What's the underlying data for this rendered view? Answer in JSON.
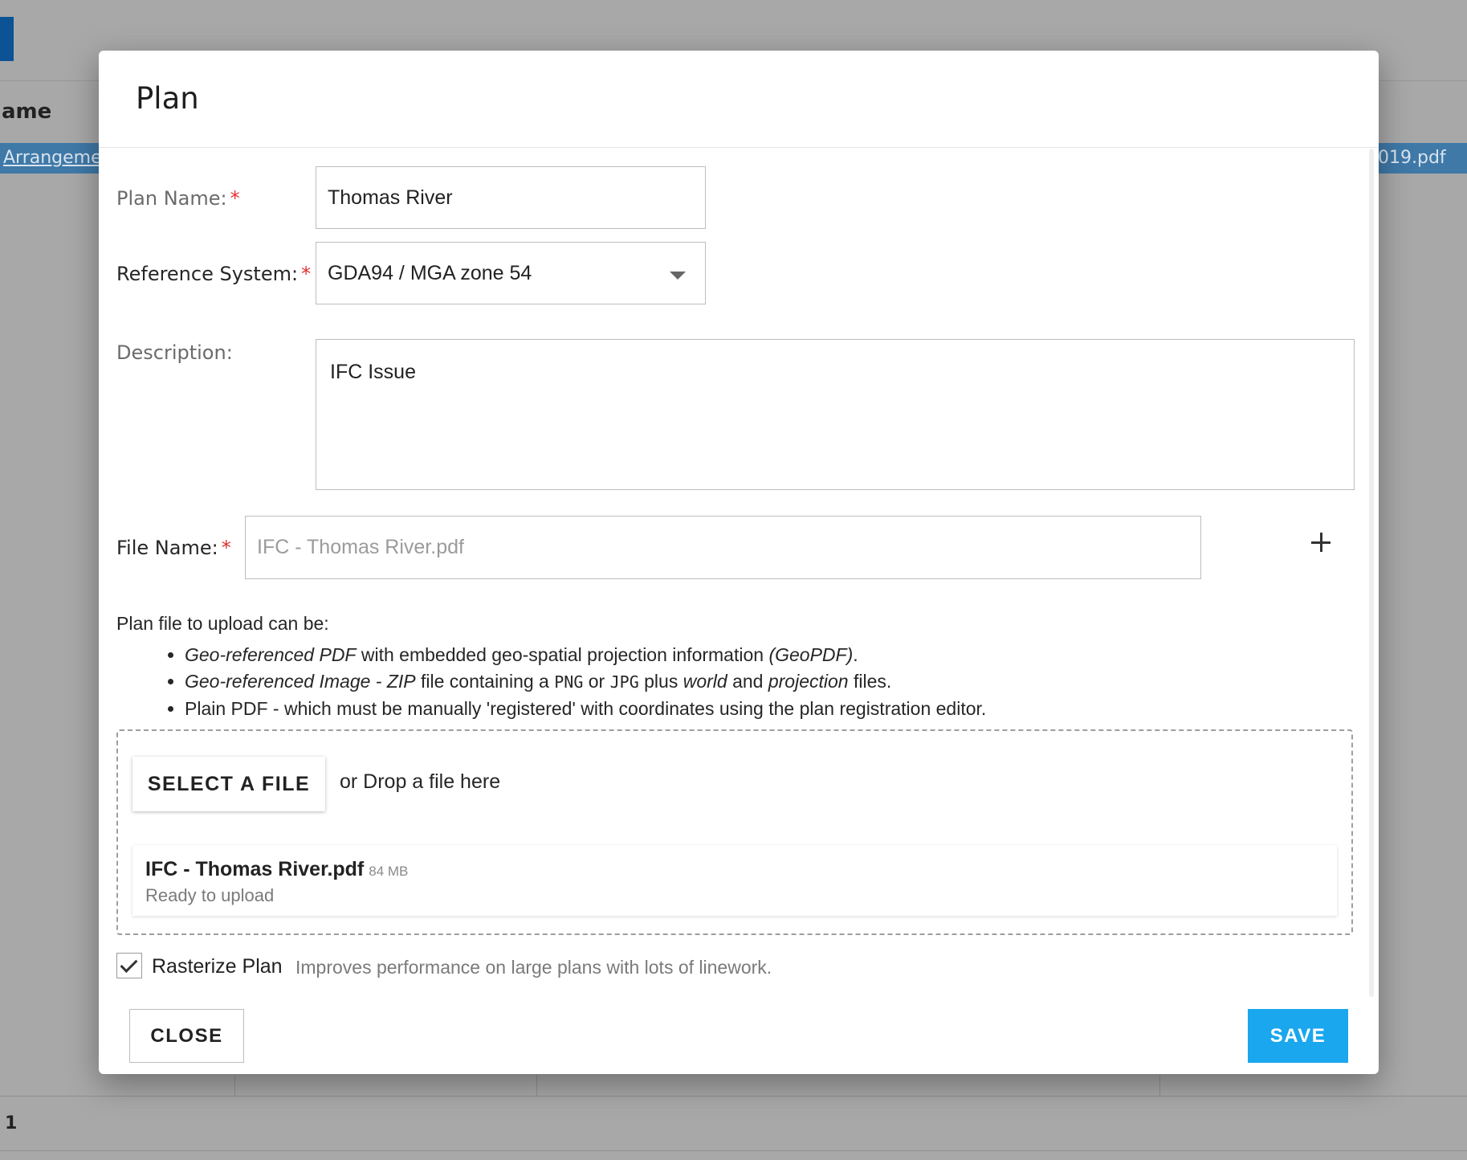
{
  "background": {
    "column_header": "ame",
    "row_link": "Arrangemen",
    "row_right": "019.pdf",
    "page_number": "1",
    "colors": {
      "overlay": "#a8a8a8",
      "selected_row": "#3f79a8",
      "primary_button": "#0b5394"
    }
  },
  "dialog": {
    "title": "Plan",
    "fields": {
      "plan_name": {
        "label": "Plan Name:",
        "required": "*",
        "value": "Thomas River"
      },
      "reference_system": {
        "label": "Reference System:",
        "required": "*",
        "value": "GDA94 / MGA zone 54"
      },
      "description": {
        "label": "Description:",
        "value": "IFC Issue"
      },
      "file_name": {
        "label": "File Name:",
        "required": "*",
        "placeholder": "IFC - Thomas River.pdf"
      }
    },
    "info": {
      "intro": "Plan file to upload can be:",
      "items": [
        {
          "part1": "Geo-referenced PDF",
          "part2": " with embedded geo-spatial projection information ",
          "part3": "(GeoPDF)",
          "part4": "."
        },
        {
          "part1": "Geo-referenced Image - ZIP",
          "part2": " file containing a ",
          "mono1": "PNG",
          "part3": " or ",
          "mono2": "JPG",
          "part4": " plus ",
          "part5": "world",
          "part6": " and ",
          "part7": "projection",
          "part8": " files."
        },
        {
          "text": "Plain PDF - which must be manually 'registered' with coordinates using the plan registration editor."
        }
      ]
    },
    "upload": {
      "select_button": "SELECT A FILE",
      "drop_text": "or Drop a file here",
      "file": {
        "name": "IFC - Thomas River.pdf",
        "size": "84 MB",
        "status": "Ready to upload"
      }
    },
    "rasterize": {
      "label": "Rasterize Plan",
      "hint": "Improves performance on large plans with lots of linework.",
      "checked": true
    },
    "buttons": {
      "close": "CLOSE",
      "save": "SAVE"
    },
    "colors": {
      "save": "#1aa7ee",
      "required": "#e03131"
    },
    "icons": {
      "dropdown": "chevron-down-icon",
      "add": "plus-icon",
      "check": "check-icon"
    }
  }
}
